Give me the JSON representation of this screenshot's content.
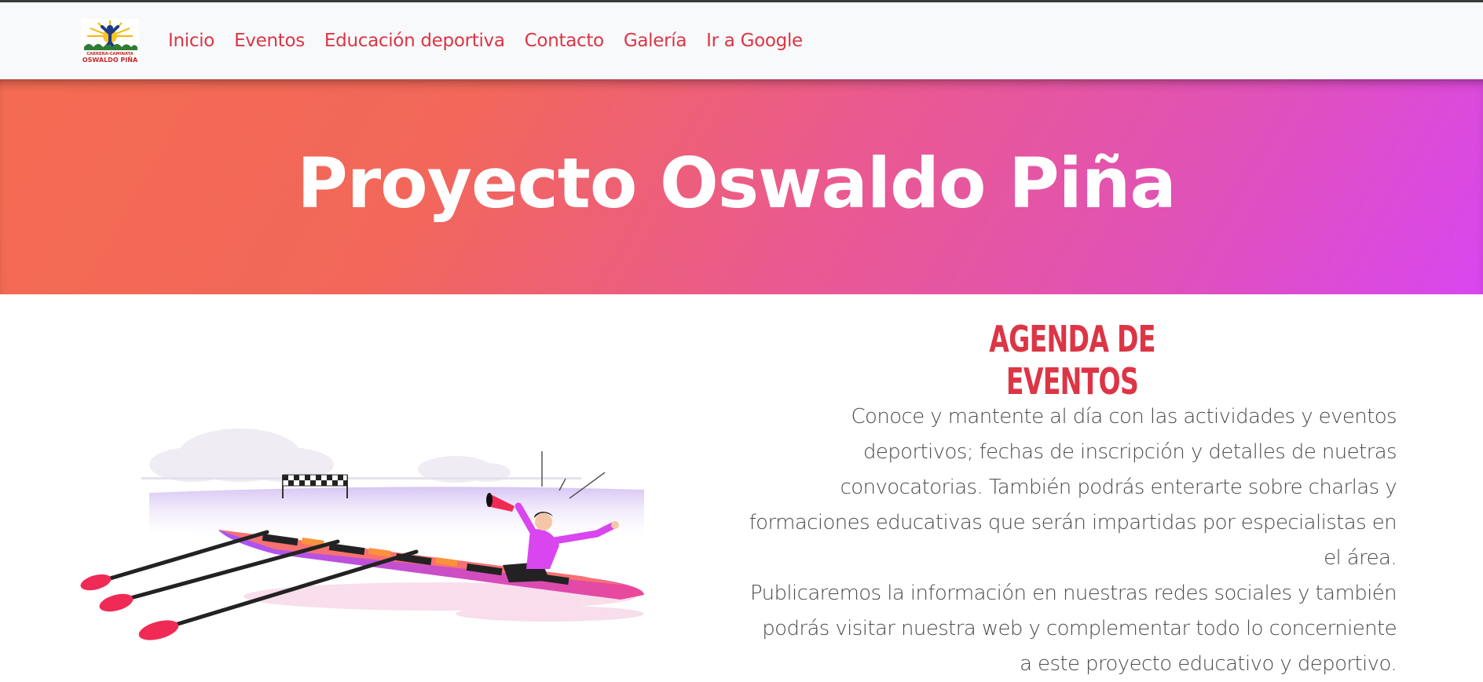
{
  "nav": {
    "logo_alt": "Carrera Caminata Oswaldo Piña",
    "logo_text_line1": "CARRERA-CAMINATA",
    "logo_text_line2": "OSWALDO PIÑA",
    "links": [
      {
        "label": "Inicio"
      },
      {
        "label": "Eventos"
      },
      {
        "label": "Educación deportiva"
      },
      {
        "label": "Contacto"
      },
      {
        "label": "Galería"
      },
      {
        "label": "Ir a Google"
      }
    ]
  },
  "hero": {
    "title": "Proyecto Oswaldo Piña"
  },
  "agenda": {
    "title": "AGENDA DE EVENTOS",
    "paragraph1": "Conoce y mantente al día con las actividades y eventos deportivos; fechas de inscripción y detalles de nuetras convocatorias. También podrás enterarte sobre charlas y formaciones educativas que serán impartidas por especialistas en el área.",
    "paragraph2": "Publicaremos la información en nuestras redes sociales y también podrás visitar nuestra web y complementar todo lo concerniente a este proyecto educativo y deportivo."
  },
  "colors": {
    "accent": "#dc3545",
    "hero_gradient_start": "#f46b52",
    "hero_gradient_end": "#d946ef",
    "navbar_bg": "#f8f9fa",
    "body_text": "#4b4b4b"
  },
  "icons": {
    "logo": "runner-logo-icon",
    "illustration": "rowing-boat-illustration"
  }
}
